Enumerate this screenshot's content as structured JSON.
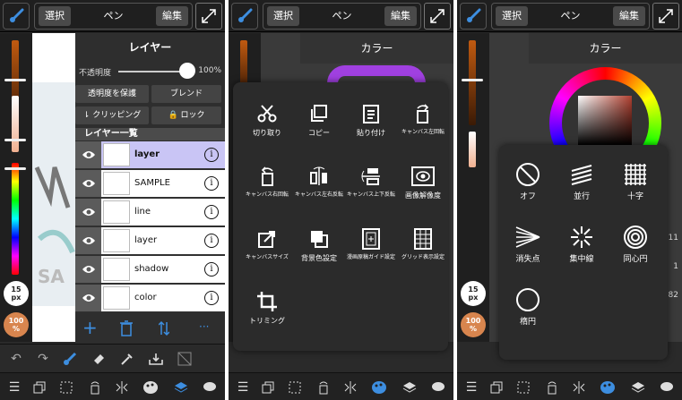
{
  "colors": {
    "accent": "#3d8ee0",
    "selected_row": "#c9c5f5",
    "panel": "#2a2a2a",
    "badge_orange": "#d8854e"
  },
  "toolbar": {
    "select_label": "選択",
    "title": "ペン",
    "edit_label": "編集"
  },
  "left": {
    "brush_size": "15",
    "brush_unit": "px",
    "opacity": "100",
    "opacity_unit": "%"
  },
  "layer_panel": {
    "title": "レイヤー",
    "opacity_label": "不透明度",
    "opacity_value": "100%",
    "opacity_level": 1.0,
    "protect_label": "透明度を保護",
    "blend_label": "ブレンド",
    "clipping_label": "クリッピング",
    "lock_label": "ロック",
    "list_title": "レイヤー一覧",
    "layers": [
      {
        "name": "layer",
        "selected": true
      },
      {
        "name": "SAMPLE",
        "selected": false
      },
      {
        "name": "line",
        "selected": false
      },
      {
        "name": "layer",
        "selected": false
      },
      {
        "name": "shadow",
        "selected": false
      },
      {
        "name": "color",
        "selected": false
      }
    ],
    "info_glyph": "i",
    "more_glyph": "···"
  },
  "canvas_text": {
    "sample_watermark": "SA"
  },
  "color_panel": {
    "title": "カラー",
    "numbers": [
      "11",
      "1",
      "82"
    ]
  },
  "edit_menu": {
    "items": [
      {
        "label": "切り取り",
        "icon": "scissors-icon"
      },
      {
        "label": "コピー",
        "icon": "copy-icon"
      },
      {
        "label": "貼り付け",
        "icon": "paste-icon"
      },
      {
        "label": "キャンバス左回転",
        "icon": "rotate-left-icon"
      },
      {
        "label": "キャンバス右回転",
        "icon": "rotate-right-icon"
      },
      {
        "label": "キャンバス左右反転",
        "icon": "flip-horizontal-icon"
      },
      {
        "label": "キャンバス上下反転",
        "icon": "flip-vertical-icon"
      },
      {
        "label": "画像解像度",
        "icon": "image-resolution-icon"
      },
      {
        "label": "キャンバスサイズ",
        "icon": "canvas-size-icon"
      },
      {
        "label": "背景色設定",
        "icon": "background-color-icon"
      },
      {
        "label": "漫画原稿ガイド設定",
        "icon": "manga-guide-icon"
      },
      {
        "label": "グリッド表示設定",
        "icon": "grid-settings-icon"
      },
      {
        "label": "トリミング",
        "icon": "crop-icon"
      }
    ]
  },
  "ruler_menu": {
    "items": [
      {
        "label": "オフ",
        "icon": "off-icon"
      },
      {
        "label": "並行",
        "icon": "parallel-icon"
      },
      {
        "label": "十字",
        "icon": "cross-grid-icon"
      },
      {
        "label": "消失点",
        "icon": "vanishing-point-icon"
      },
      {
        "label": "集中線",
        "icon": "radial-lines-icon"
      },
      {
        "label": "同心円",
        "icon": "concentric-icon"
      },
      {
        "label": "楕円",
        "icon": "ellipse-icon"
      }
    ]
  }
}
